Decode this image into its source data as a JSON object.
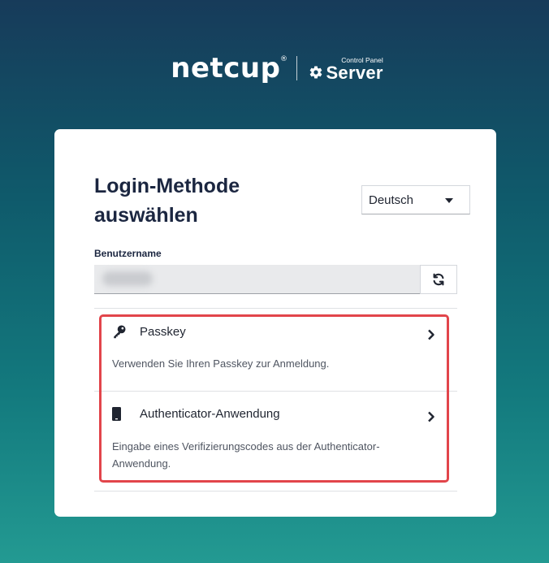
{
  "brand": {
    "name": "netcup",
    "registered": "®",
    "product_sub": "Control Panel",
    "product_main": "Server",
    "logo_icon": "gear-icon"
  },
  "login": {
    "title_line1": "Login-Methode",
    "title_line2": "auswählen",
    "language": {
      "selected": "Deutsch"
    },
    "username": {
      "label": "Benutzername",
      "value_redacted": true
    },
    "refresh_icon": "refresh-icon"
  },
  "methods": [
    {
      "icon": "key-icon",
      "title": "Passkey",
      "description": "Verwenden Sie Ihren Passkey zur Anmeldung."
    },
    {
      "icon": "phone-icon",
      "title": "Authenticator-Anwendung",
      "description": "Eingabe eines Verifizierungscodes aus der Authenticator-Anwendung."
    }
  ],
  "colors": {
    "highlight": "#e2454b",
    "title": "#1b2640",
    "background_top": "#173b5a",
    "background_bottom": "#239a92"
  }
}
